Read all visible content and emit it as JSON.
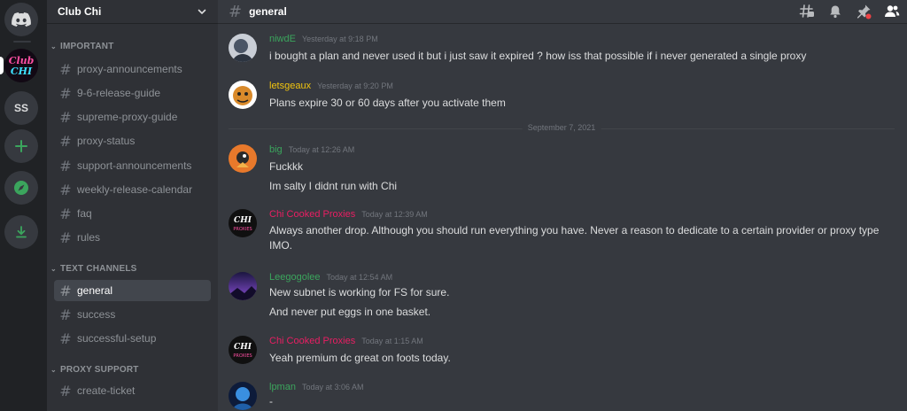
{
  "server": {
    "name": "Club Chi",
    "dm_initials": "SS"
  },
  "categories": {
    "important": "IMPORTANT",
    "text_channels": "TEXT CHANNELS",
    "proxy_support": "PROXY SUPPORT"
  },
  "channels": {
    "important": [
      "proxy-announcements",
      "9-6-release-guide",
      "supreme-proxy-guide",
      "proxy-status",
      "support-announcements",
      "weekly-release-calendar",
      "faq",
      "rules"
    ],
    "text": [
      "general",
      "success",
      "successful-setup"
    ],
    "support": [
      "create-ticket"
    ]
  },
  "active_channel": "general",
  "date_divider": "September 7, 2021",
  "messages": [
    {
      "author": "niwdE",
      "color": "#3ba55d",
      "time": "Yesterday at 9:18 PM",
      "lines": [
        "i bought a plan and never used it but i just saw it expired ? how iss that possible if i never generated a single proxy"
      ]
    },
    {
      "author": "letsgeaux",
      "color": "#f1c40f",
      "time": "Yesterday at 9:20 PM",
      "lines": [
        "Plans expire 30 or 60 days after you activate them"
      ]
    },
    {
      "author": "big",
      "color": "#3ba55d",
      "time": "Today at 12:26 AM",
      "lines": [
        "Fuckkk",
        "Im salty I didnt run with Chi"
      ]
    },
    {
      "author": "Chi Cooked Proxies",
      "color": "#e91e63",
      "time": "Today at 12:39 AM",
      "lines": [
        "Always another drop. Although you should run everything you have. Never a reason to dedicate to a certain provider or proxy type IMO."
      ]
    },
    {
      "author": "Leegogolee",
      "color": "#3ba55d",
      "time": "Today at 12:54 AM",
      "lines": [
        "New subnet is working for FS for sure.",
        "And never put eggs in one basket."
      ]
    },
    {
      "author": "Chi Cooked Proxies",
      "color": "#e91e63",
      "time": "Today at 1:15 AM",
      "lines": [
        "Yeah premium dc great on foots today."
      ]
    },
    {
      "author": "lpman",
      "color": "#3ba55d",
      "time": "Today at 3:06 AM",
      "lines": [
        "-"
      ]
    }
  ],
  "icons": {
    "rail": [
      "discord-logo-icon",
      "club-chi-server-icon",
      "add-server-icon",
      "explore-icon",
      "download-icon"
    ],
    "topbar": [
      "threads-icon",
      "bell-icon",
      "pin-icon",
      "members-icon"
    ]
  }
}
